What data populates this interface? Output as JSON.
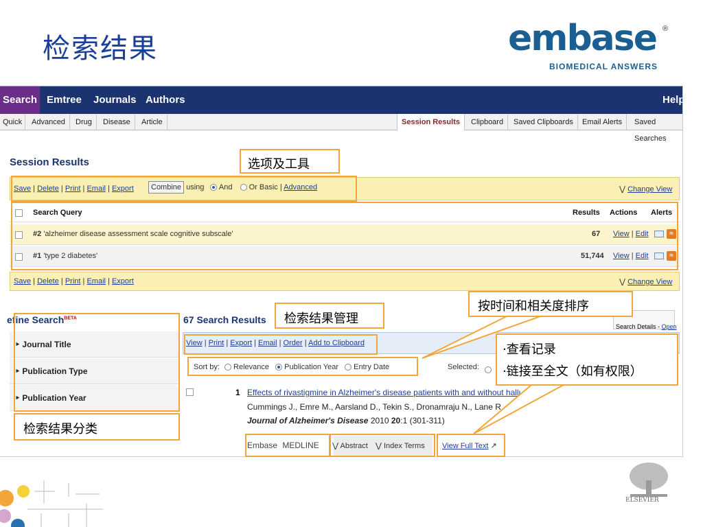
{
  "slide": {
    "title": "检索结果"
  },
  "logo": {
    "word": "embase",
    "reg": "®",
    "tagline": "BIOMEDICAL ANSWERS"
  },
  "mainnav": [
    "Search",
    "Emtree",
    "Journals",
    "Authors",
    "Help"
  ],
  "subnav_left": [
    "Quick",
    "Advanced",
    "Drug",
    "Disease",
    "Article"
  ],
  "subnav_right": [
    "Session Results",
    "Clipboard",
    "Saved Clipboards",
    "Email Alerts",
    "Saved Searches"
  ],
  "session": {
    "heading": "Session Results",
    "toolbar_links": [
      "Save",
      "Delete",
      "Print",
      "Email",
      "Export"
    ],
    "combine_label": "Combine",
    "using_label": "using",
    "and_label": "And",
    "or_label": "Or",
    "basic_label": "Basic",
    "advanced_label": "Advanced",
    "change_view": "Change View",
    "col_query": "Search Query",
    "col_results": "Results",
    "col_actions": "Actions",
    "col_alerts": "Alerts",
    "rows": [
      {
        "num": "#2",
        "query": "'alzheimer disease assessment scale cognitive subscale'",
        "results": "67",
        "view": "View",
        "edit": "Edit"
      },
      {
        "num": "#1",
        "query": "'type 2 diabetes'",
        "results": "51,744",
        "view": "View",
        "edit": "Edit"
      }
    ]
  },
  "refine": {
    "heading": "efine Search",
    "beta": "BETA",
    "items": [
      "Journal Title",
      "Publication Type",
      "Publication Year"
    ]
  },
  "results": {
    "heading": "67 Search Results",
    "toolbar": [
      "View",
      "Print",
      "Export",
      "Email",
      "Order",
      "Add to Clipboard"
    ],
    "sort_by": "Sort by:",
    "sort_options": [
      "Relevance",
      "Publication Year",
      "Entry Date"
    ],
    "selected_label": "Selected:",
    "search_details": "Search Details -",
    "open_label": "Open",
    "record": {
      "num": "1",
      "title": "Effects of rivastigmine in Alzheimer's disease patients with and without hallu",
      "authors": "Cummings J., Emre M., Aarsland D., Tekin S., Dronamraju N., Lane R",
      "journal": "Journal of Alzheimer's Disease",
      "year": "2010",
      "volume": "20",
      "issue": ":1",
      "pages": "(301-311)",
      "sources": [
        "Embase",
        "MEDLINE"
      ],
      "abstract": "Abstract",
      "index_terms": "Index Terms",
      "full_text": "View Full Text"
    }
  },
  "callouts": {
    "options_tools": "选项及工具",
    "result_mgmt": "检索结果管理",
    "sort_note": "按时间和相关度排序",
    "view_record": "·查看记录",
    "link_fulltext": "·链接至全文（如有权限）",
    "categories": "检索结果分类"
  },
  "elsevier": "ELSEVIER",
  "colors": {
    "nav": "#1b3470",
    "active_nav": "#6a2d88",
    "callout_border": "#f4a53a",
    "yellow_bar": "#fbf0b4"
  }
}
